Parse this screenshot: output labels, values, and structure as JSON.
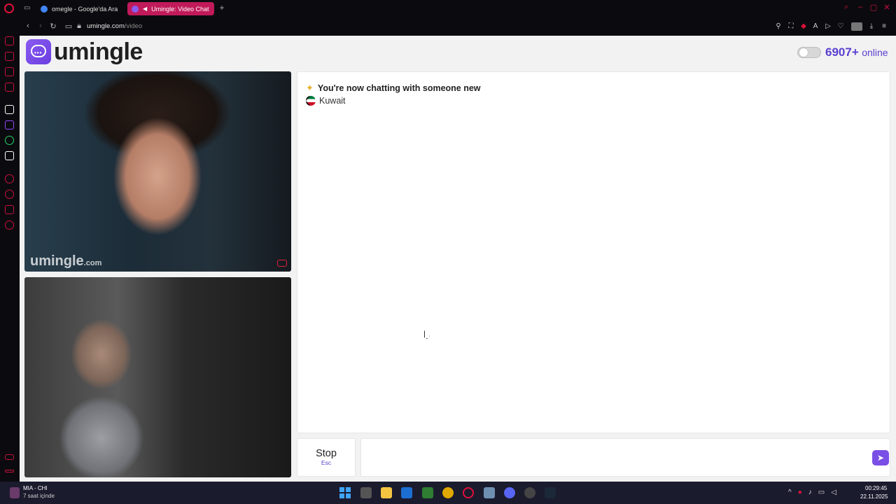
{
  "browser": {
    "tabs": [
      {
        "label": "omegle - Google'da Ara",
        "favicon_color": "#4285f4"
      },
      {
        "label": "Umingle: Video Chat",
        "favicon_color": "#8a5cf0",
        "active": true
      }
    ],
    "address": {
      "host": "umingle.com",
      "path": "/video"
    }
  },
  "header": {
    "logo_text": "umingle",
    "online_count": "6907+",
    "online_label": "online"
  },
  "video": {
    "watermark": "umingle",
    "watermark_domain": ".com"
  },
  "chat": {
    "status_message": "You're now chatting with someone new",
    "country": "Kuwait",
    "message_placeholder": ""
  },
  "controls": {
    "stop_label": "Stop",
    "stop_shortcut": "Esc"
  },
  "taskbar": {
    "media_title": "MIA - CHI",
    "media_subtitle": "7 saat içinde",
    "time": "00:29:45",
    "date": "22.11.2025"
  },
  "colors": {
    "brand": "#7a4fe6",
    "opera_accent": "#e0103a",
    "active_tab": "#c11a5a"
  }
}
